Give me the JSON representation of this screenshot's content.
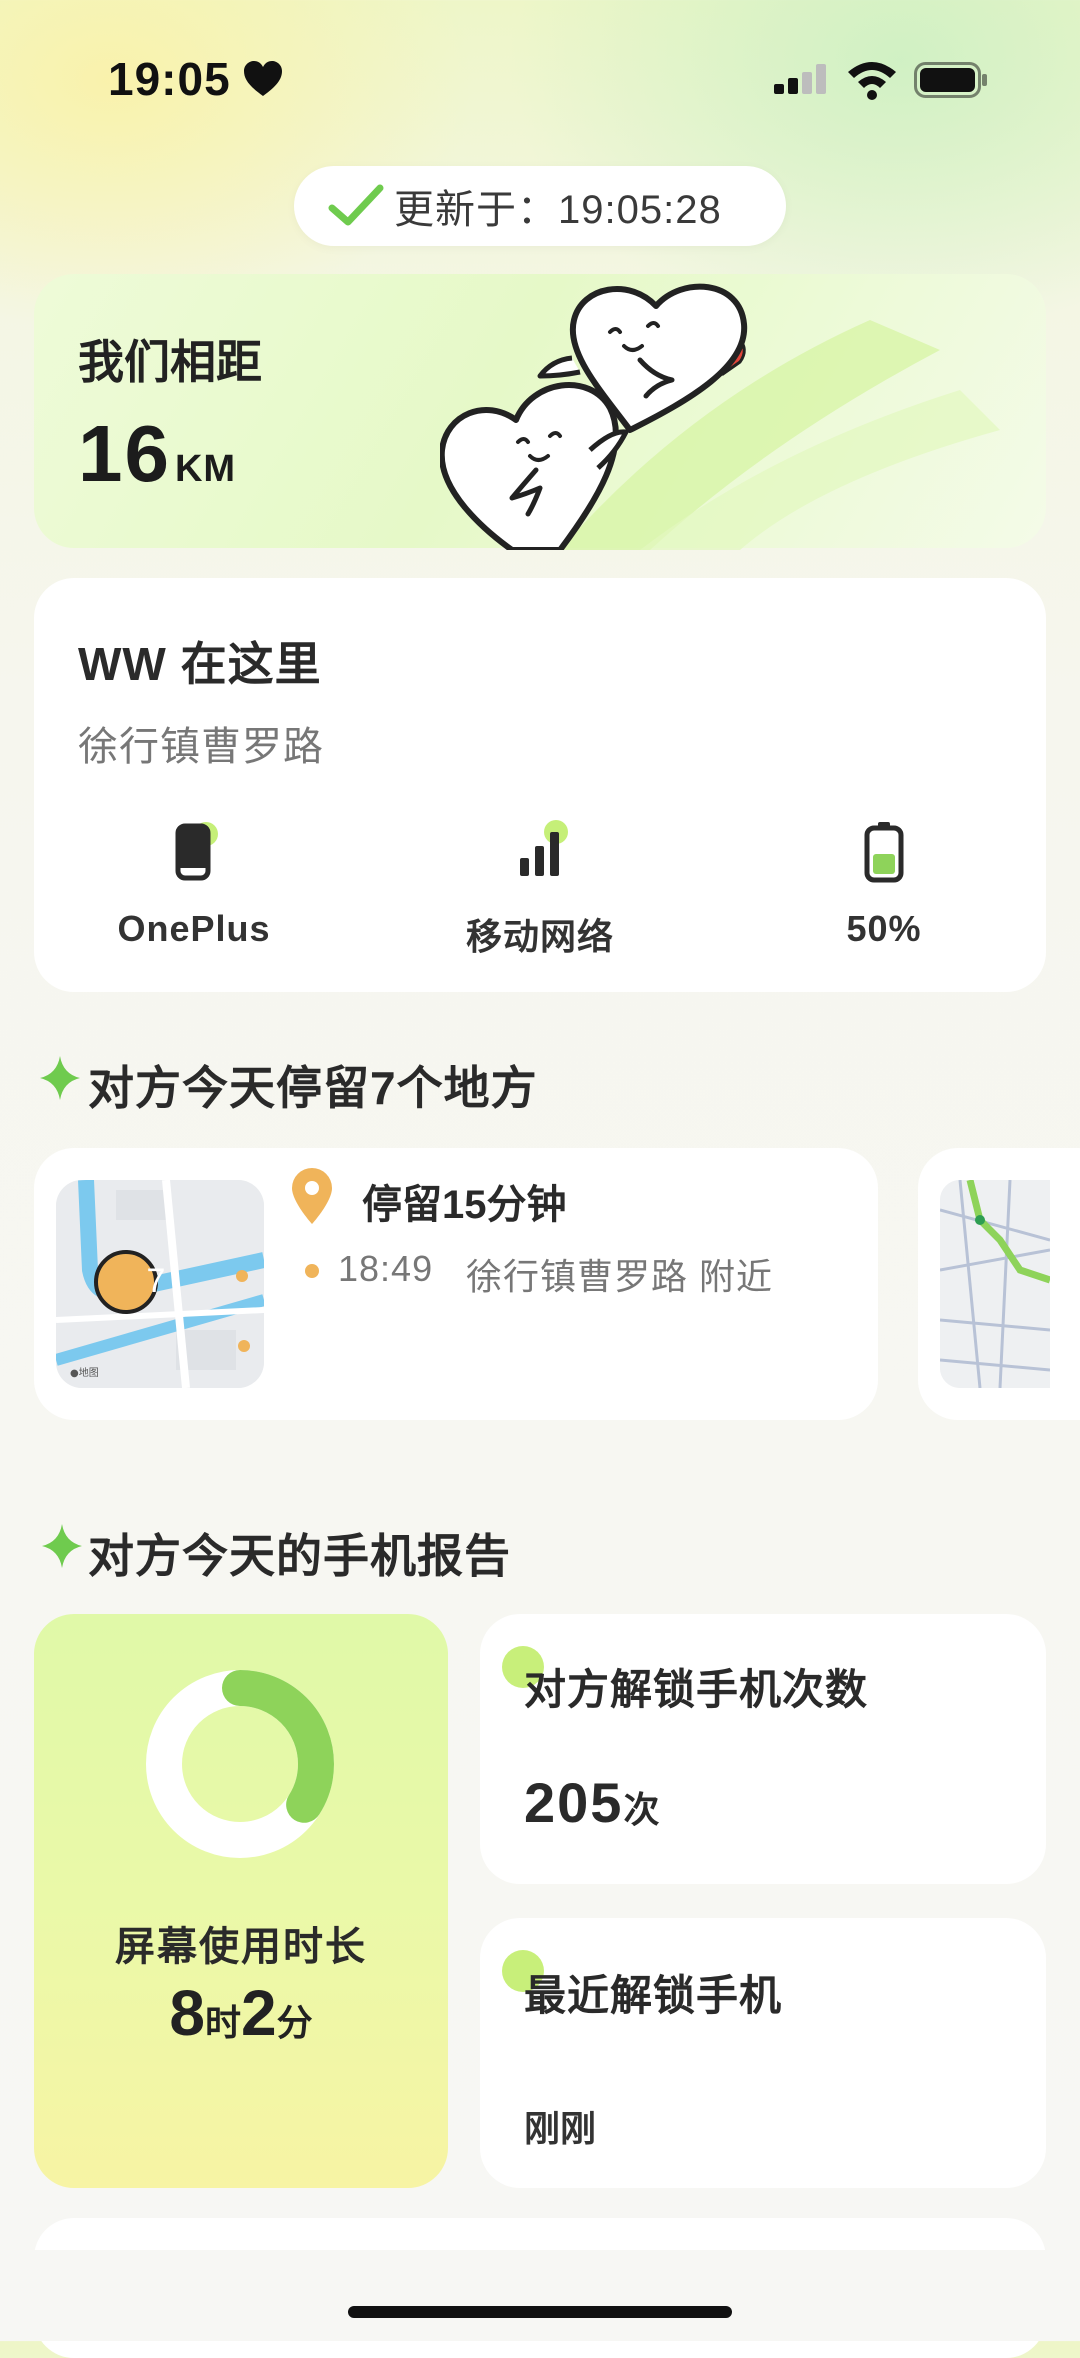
{
  "status_bar": {
    "time": "19:05"
  },
  "update": {
    "text": "更新于：19:05:28"
  },
  "distance": {
    "label": "我们相距",
    "value": "16",
    "unit": "KM"
  },
  "location": {
    "title": "WW 在这里",
    "address": "徐行镇曹罗路",
    "stats": [
      {
        "icon": "phone-icon",
        "label": "OnePlus"
      },
      {
        "icon": "signal-bars-icon",
        "label": "移动网络"
      },
      {
        "icon": "battery-icon",
        "label": "50%",
        "level": 0.5
      }
    ]
  },
  "places": {
    "title": "对方今天停留7个地方",
    "items": [
      {
        "badge": "7",
        "duration": "停留15分钟",
        "time": "18:49",
        "place": "徐行镇曹罗路 附近"
      }
    ]
  },
  "report": {
    "title": "对方今天的手机报告",
    "screen_time": {
      "label": "屏幕使用时长",
      "hours": "8",
      "hours_unit": "时",
      "minutes": "2",
      "minutes_unit": "分",
      "ring_fraction": 0.34
    },
    "unlock_count": {
      "title": "对方解锁手机次数",
      "value": "205",
      "unit": "次"
    },
    "recent_unlock": {
      "title": "最近解锁手机",
      "value": "刚刚"
    }
  },
  "colors": {
    "accent_green": "#8ed35a",
    "pin_orange": "#f0b45a",
    "heart_red": "#e0453a"
  }
}
